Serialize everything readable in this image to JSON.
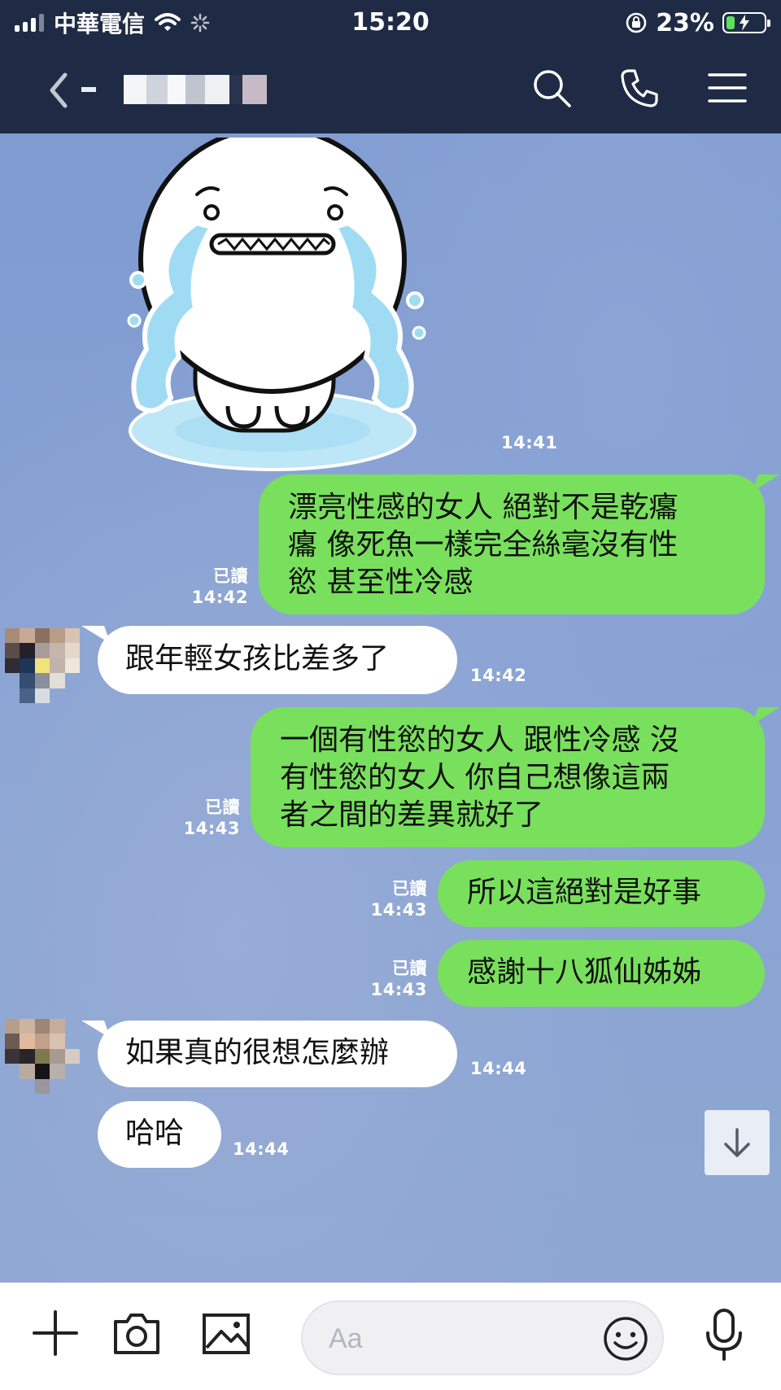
{
  "status_bar": {
    "carrier": "中華電信",
    "time": "15:20",
    "battery": "23%",
    "battery_level": 0.23
  },
  "header": {
    "search_icon": "search-icon",
    "call_icon": "phone-icon",
    "menu_icon": "menu-icon"
  },
  "messages": [
    {
      "id": "sticker",
      "type": "sticker",
      "direction": "in",
      "time": "14:41"
    },
    {
      "id": "m1",
      "direction": "out",
      "read": "已讀",
      "time": "14:42",
      "lines": [
        "漂亮性感的女人 絕對不是乾癟",
        "癟 像死魚一樣完全絲毫沒有性",
        "慾 甚至性冷感"
      ]
    },
    {
      "id": "m2",
      "direction": "in",
      "time": "14:42",
      "lines": [
        "跟年輕女孩比差多了"
      ]
    },
    {
      "id": "m3",
      "direction": "out",
      "read": "已讀",
      "time": "14:43",
      "lines": [
        "一個有性慾的女人 跟性冷感 沒",
        "有性慾的女人 你自己想像這兩",
        "者之間的差異就好了"
      ]
    },
    {
      "id": "m4",
      "direction": "out",
      "read": "已讀",
      "time": "14:43",
      "lines": [
        "所以這絕對是好事"
      ]
    },
    {
      "id": "m5",
      "direction": "out",
      "read": "已讀",
      "time": "14:43",
      "lines": [
        "感謝十八狐仙姊姊"
      ]
    },
    {
      "id": "m6",
      "direction": "in",
      "time": "14:44",
      "lines": [
        "如果真的很想怎麼辦"
      ]
    },
    {
      "id": "m7",
      "direction": "in",
      "time": "14:44",
      "lines": [
        "哈哈"
      ]
    }
  ],
  "input": {
    "placeholder": "Aa"
  },
  "colors": {
    "header_bg": "#1f2b45",
    "outgoing_bubble": "#79e05d",
    "incoming_bubble": "#ffffff",
    "chat_bg": "#88a2d3"
  }
}
